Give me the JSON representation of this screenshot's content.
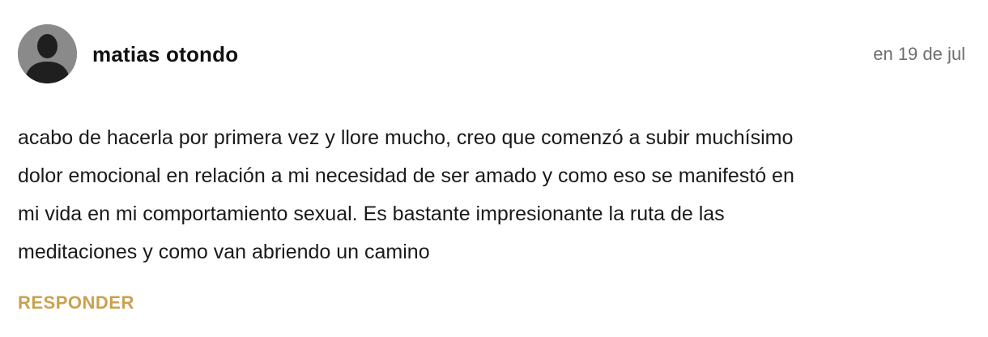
{
  "comment": {
    "author": "matias otondo",
    "date": "en 19 de jul",
    "lines": [
      "acabo de hacerla por primera vez y llore mucho, creo que comenzó a subir muchísimo",
      "dolor emocional en relación a mi necesidad de ser amado y como eso se manifestó en",
      "mi vida en mi comportamiento sexual. Es bastante impresionante la ruta de las",
      "meditaciones y como van abriendo un camino"
    ],
    "reply_label": "RESPONDER",
    "avatar_icon": "default-user-silhouette"
  },
  "colors": {
    "accent": "#c9a24f",
    "date": "#6f6f6f",
    "avatar_bg": "#8a8a8a",
    "avatar_fg": "#1f1f1f"
  }
}
